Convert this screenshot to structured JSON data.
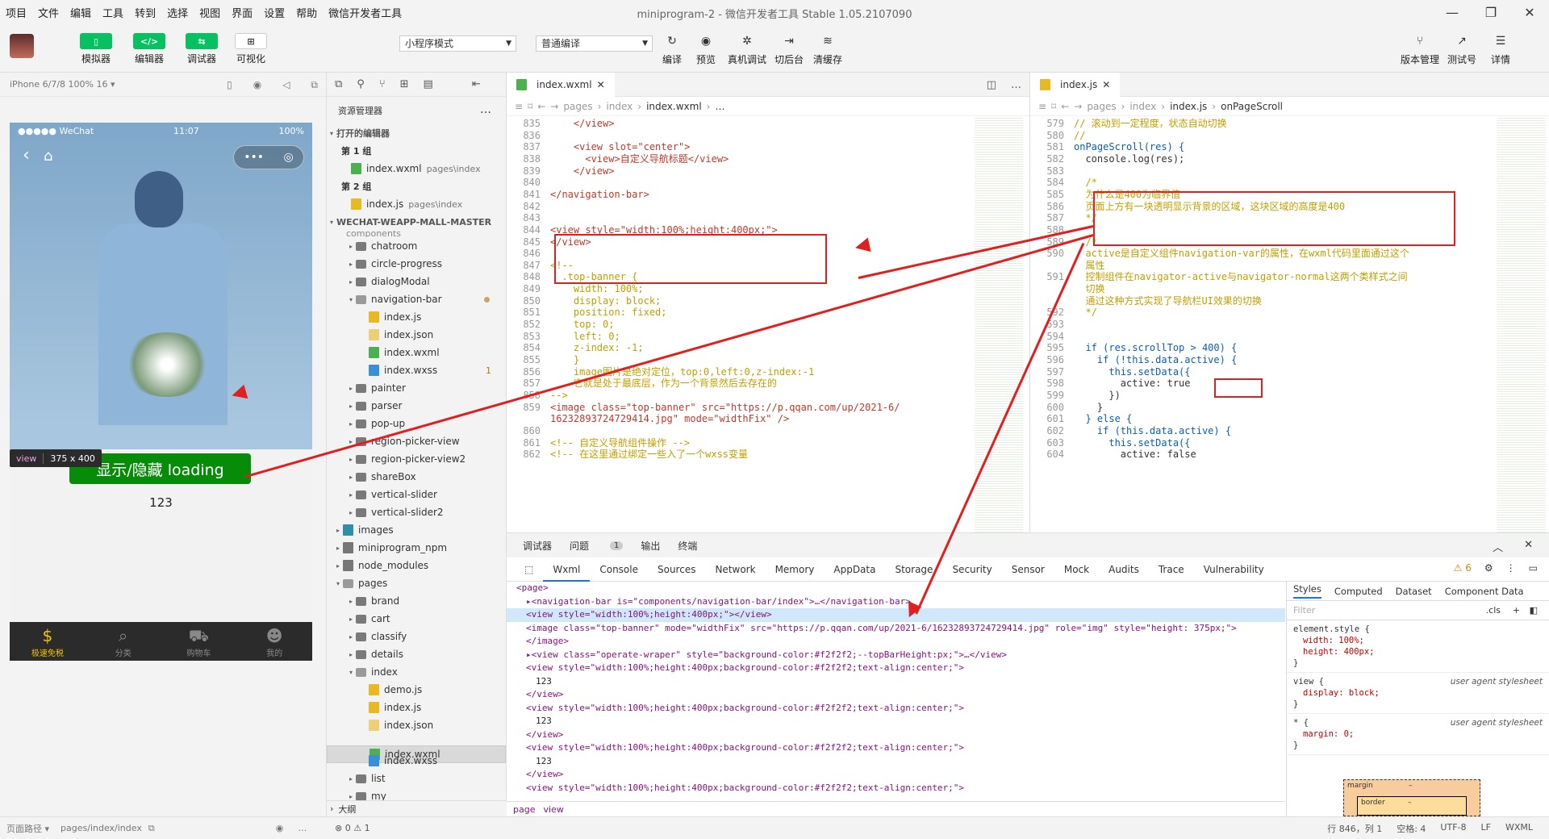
{
  "menu": [
    "项目",
    "文件",
    "编辑",
    "工具",
    "转到",
    "选择",
    "视图",
    "界面",
    "设置",
    "帮助",
    "微信开发者工具"
  ],
  "window_title": "miniprogram-2 - 微信开发者工具 Stable 1.05.2107090",
  "toolbar": {
    "left": [
      {
        "icon": "phone-icon",
        "label": "模拟器"
      },
      {
        "icon": "code-icon",
        "label": "编辑器"
      },
      {
        "icon": "debug-icon",
        "label": "调试器"
      },
      {
        "icon": "visual-icon",
        "label": "可视化"
      }
    ],
    "mode_select": "小程序模式",
    "compile_select": "普通编译",
    "mid": [
      {
        "icon": "refresh-icon",
        "label": "编译"
      },
      {
        "icon": "eye-icon",
        "label": "预览"
      },
      {
        "icon": "bug-icon",
        "label": "真机调试"
      },
      {
        "icon": "switch-icon",
        "label": "切后台"
      },
      {
        "icon": "layers-icon",
        "label": "清缓存"
      }
    ],
    "right": [
      {
        "icon": "branch-icon",
        "label": "版本管理"
      },
      {
        "icon": "share-icon",
        "label": "测试号"
      },
      {
        "icon": "menu-icon",
        "label": "详情"
      }
    ]
  },
  "simulator": {
    "device": "iPhone 6/7/8 100% 16 ▾",
    "status_left": "●●●●● WeChat",
    "status_time": "11:07",
    "status_right": "100%",
    "tooltip_tag": "view",
    "tooltip_size": "375 x 400",
    "button_label": "显示/隐藏 loading",
    "content_text": "123",
    "tabs": [
      {
        "label": "极速免税",
        "active": true,
        "icon": "money-bag-icon"
      },
      {
        "label": "分类",
        "active": false,
        "icon": "search-list-icon"
      },
      {
        "label": "购物车",
        "active": false,
        "icon": "cart-icon"
      },
      {
        "label": "我的",
        "active": false,
        "icon": "user-icon"
      }
    ],
    "footer_path_label": "页面路径 ▾",
    "footer_path": "pages/index/index"
  },
  "explorer": {
    "title": "资源管理器",
    "open_editors": "打开的编辑器",
    "groups": [
      {
        "name": "第 1 组",
        "file": "index.wxml",
        "path": "pages\\index"
      },
      {
        "name": "第 2 组",
        "file": "index.js",
        "path": "pages\\index"
      }
    ],
    "project": "WECHAT-WEAPP-MALL-MASTER",
    "cut_off": "components",
    "tree": [
      {
        "name": "chatroom",
        "type": "folder",
        "depth": 1
      },
      {
        "name": "circle-progress",
        "type": "folder",
        "depth": 1
      },
      {
        "name": "dialogModal",
        "type": "folder",
        "depth": 1
      },
      {
        "name": "navigation-bar",
        "type": "folderopen",
        "depth": 1
      },
      {
        "name": "index.js",
        "type": "js",
        "depth": 2
      },
      {
        "name": "index.json",
        "type": "json",
        "depth": 2
      },
      {
        "name": "index.wxml",
        "type": "wxml",
        "depth": 2
      },
      {
        "name": "index.wxss",
        "type": "wxss",
        "depth": 2,
        "badge": "1"
      },
      {
        "name": "painter",
        "type": "folder",
        "depth": 1
      },
      {
        "name": "parser",
        "type": "folder",
        "depth": 1
      },
      {
        "name": "pop-up",
        "type": "folder",
        "depth": 1
      },
      {
        "name": "region-picker-view",
        "type": "folder",
        "depth": 1
      },
      {
        "name": "region-picker-view2",
        "type": "folder",
        "depth": 1
      },
      {
        "name": "shareBox",
        "type": "folder",
        "depth": 1
      },
      {
        "name": "vertical-slider",
        "type": "folder",
        "depth": 1
      },
      {
        "name": "vertical-slider2",
        "type": "folder",
        "depth": 1
      },
      {
        "name": "images",
        "type": "img",
        "depth": 0
      },
      {
        "name": "miniprogram_npm",
        "type": "npm",
        "depth": 0
      },
      {
        "name": "node_modules",
        "type": "npm",
        "depth": 0
      },
      {
        "name": "pages",
        "type": "folderopen",
        "depth": 0
      },
      {
        "name": "brand",
        "type": "folder",
        "depth": 1
      },
      {
        "name": "cart",
        "type": "folder",
        "depth": 1
      },
      {
        "name": "classify",
        "type": "folder",
        "depth": 1
      },
      {
        "name": "details",
        "type": "folder",
        "depth": 1
      },
      {
        "name": "index",
        "type": "folderopen",
        "depth": 1
      },
      {
        "name": "demo.js",
        "type": "js",
        "depth": 2
      },
      {
        "name": "index.js",
        "type": "js",
        "depth": 2
      },
      {
        "name": "index.json",
        "type": "json",
        "depth": 2
      },
      {
        "name": "index.wxml",
        "type": "wxml",
        "depth": 2,
        "selected": true
      },
      {
        "name": "index.wxss",
        "type": "wxss",
        "depth": 2
      },
      {
        "name": "list",
        "type": "folder",
        "depth": 1
      },
      {
        "name": "my",
        "type": "folder",
        "depth": 1
      }
    ],
    "outline": "大纲"
  },
  "editor1": {
    "tab": "index.wxml",
    "crumb": [
      "pages",
      "index",
      "index.wxml",
      "…"
    ],
    "lines": [
      {
        "n": "835",
        "t": "    </view>",
        "c": "tag"
      },
      {
        "n": "836",
        "t": "",
        "c": ""
      },
      {
        "n": "837",
        "t": "    <view slot=\"center\">",
        "c": "tag"
      },
      {
        "n": "838",
        "t": "      <view>自定义导航标题</view>",
        "c": "tag"
      },
      {
        "n": "839",
        "t": "    </view>",
        "c": "tag"
      },
      {
        "n": "840",
        "t": "",
        "c": ""
      },
      {
        "n": "841",
        "t": "</navigation-bar>",
        "c": "tag"
      },
      {
        "n": "842",
        "t": "",
        "c": ""
      },
      {
        "n": "843",
        "t": "",
        "c": ""
      },
      {
        "n": "844",
        "t": "<view style=\"width:100%;height:400px;\">",
        "c": "tag"
      },
      {
        "n": "845",
        "t": "</view>",
        "c": "tag"
      },
      {
        "n": "846",
        "t": "",
        "c": ""
      },
      {
        "n": "847",
        "t": "<!--",
        "c": "cmt"
      },
      {
        "n": "848",
        "t": "  .top-banner {",
        "c": "cmt"
      },
      {
        "n": "849",
        "t": "    width: 100%;",
        "c": "cmt"
      },
      {
        "n": "850",
        "t": "    display: block;",
        "c": "cmt"
      },
      {
        "n": "851",
        "t": "    position: fixed;",
        "c": "cmt"
      },
      {
        "n": "852",
        "t": "    top: 0;",
        "c": "cmt"
      },
      {
        "n": "853",
        "t": "    left: 0;",
        "c": "cmt"
      },
      {
        "n": "854",
        "t": "    z-index: -1;",
        "c": "cmt"
      },
      {
        "n": "855",
        "t": "    }",
        "c": "cmt"
      },
      {
        "n": "856",
        "t": "    image图片是绝对定位，top:0,left:0,z-index:-1",
        "c": "cmt"
      },
      {
        "n": "857",
        "t": "    它就是处于最底层，作为一个背景然后去存在的",
        "c": "cmt"
      },
      {
        "n": "858",
        "t": "-->",
        "c": "cmt"
      },
      {
        "n": "859",
        "t": "<image class=\"top-banner\" src=\"https://p.qqan.com/up/2021-6/",
        "c": "tag"
      },
      {
        "n": "",
        "t": "16232893724729414.jpg\" mode=\"widthFix\" />",
        "c": "tag"
      },
      {
        "n": "860",
        "t": "",
        "c": ""
      },
      {
        "n": "861",
        "t": "<!-- 自定义导航组件操作 -->",
        "c": "cmt"
      },
      {
        "n": "862",
        "t": "<!-- 在这里通过绑定一些入了一个wxss变量",
        "c": "cmt"
      }
    ]
  },
  "editor2": {
    "tab": "index.js",
    "crumb": [
      "pages",
      "index",
      "index.js",
      "onPageScroll"
    ],
    "lines": [
      {
        "n": "579",
        "t": "// 滚动到一定程度，状态自动切换",
        "c": "cmt"
      },
      {
        "n": "580",
        "t": "//",
        "c": "cmt"
      },
      {
        "n": "581",
        "t": "onPageScroll(res) {",
        "c": "kw"
      },
      {
        "n": "582",
        "t": "  console.log(res);",
        "c": ""
      },
      {
        "n": "583",
        "t": "",
        "c": ""
      },
      {
        "n": "584",
        "t": "  /*",
        "c": "cmt"
      },
      {
        "n": "585",
        "t": "  为什么是400为临界值",
        "c": "cmt"
      },
      {
        "n": "586",
        "t": "  页面上方有一块透明显示背景的区域，这块区域的高度是400",
        "c": "cmt"
      },
      {
        "n": "587",
        "t": "  */",
        "c": "cmt"
      },
      {
        "n": "588",
        "t": "",
        "c": ""
      },
      {
        "n": "589",
        "t": "  /*",
        "c": "cmt"
      },
      {
        "n": "590",
        "t": "  active是自定义组件navigation-var的属性，在wxml代码里面通过这个",
        "c": "cmt"
      },
      {
        "n": "",
        "t": "  属性",
        "c": "cmt"
      },
      {
        "n": "591",
        "t": "  控制组件在navigator-active与navigator-normal这两个类样式之间",
        "c": "cmt"
      },
      {
        "n": "",
        "t": "  切换",
        "c": "cmt"
      },
      {
        "n": "",
        "t": "  通过这种方式实现了导航栏UI效果的切换",
        "c": "cmt"
      },
      {
        "n": "592",
        "t": "  */",
        "c": "cmt"
      },
      {
        "n": "593",
        "t": "",
        "c": ""
      },
      {
        "n": "594",
        "t": "",
        "c": ""
      },
      {
        "n": "595",
        "t": "  if (res.scrollTop > 400) {",
        "c": "kw"
      },
      {
        "n": "596",
        "t": "    if (!this.data.active) {",
        "c": "kw"
      },
      {
        "n": "597",
        "t": "      this.setData({",
        "c": "kw"
      },
      {
        "n": "598",
        "t": "        active: true",
        "c": ""
      },
      {
        "n": "599",
        "t": "      })",
        "c": ""
      },
      {
        "n": "600",
        "t": "    }",
        "c": ""
      },
      {
        "n": "601",
        "t": "  } else {",
        "c": "kw"
      },
      {
        "n": "602",
        "t": "    if (this.data.active) {",
        "c": "kw"
      },
      {
        "n": "603",
        "t": "      this.setData({",
        "c": "kw"
      },
      {
        "n": "604",
        "t": "        active: false",
        "c": ""
      }
    ]
  },
  "devtools": {
    "top_tabs": [
      "调试器",
      "问题",
      "输出",
      "终端"
    ],
    "issues_count": "1",
    "warn_count": "⚠ 6",
    "tabs": [
      "Wxml",
      "Console",
      "Sources",
      "Network",
      "Memory",
      "AppData",
      "Storage",
      "Security",
      "Sensor",
      "Mock",
      "Audits",
      "Trace",
      "Vulnerability"
    ],
    "dom": [
      {
        "indent": 0,
        "text": "<page>"
      },
      {
        "indent": 1,
        "text": "▸<navigation-bar is=\"components/navigation-bar/index\">…</navigation-bar>"
      },
      {
        "indent": 1,
        "text": "<view style=\"width:100%;height:400px;\"></view>",
        "hl": true
      },
      {
        "indent": 1,
        "text": "<image class=\"top-banner\" mode=\"widthFix\" src=\"https://p.qqan.com/up/2021-6/16232893724729414.jpg\" role=\"img\" style=\"height: 375px;\">"
      },
      {
        "indent": 1,
        "text": "</image>"
      },
      {
        "indent": 1,
        "text": "▸<view class=\"operate-wraper\" style=\"background-color:#f2f2f2;--topBarHeight:px;\">…</view>"
      },
      {
        "indent": 1,
        "text": "<view style=\"width:100%;height:400px;background-color:#f2f2f2;text-align:center;\">"
      },
      {
        "indent": 2,
        "text": "123"
      },
      {
        "indent": 1,
        "text": "</view>"
      },
      {
        "indent": 1,
        "text": "<view style=\"width:100%;height:400px;background-color:#f2f2f2;text-align:center;\">"
      },
      {
        "indent": 2,
        "text": "123"
      },
      {
        "indent": 1,
        "text": "</view>"
      },
      {
        "indent": 1,
        "text": "<view style=\"width:100%;height:400px;background-color:#f2f2f2;text-align:center;\">"
      },
      {
        "indent": 2,
        "text": "123"
      },
      {
        "indent": 1,
        "text": "</view>"
      },
      {
        "indent": 1,
        "text": "<view style=\"width:100%;height:400px;background-color:#f2f2f2;text-align:center;\">"
      }
    ],
    "dom_crumb": [
      "page",
      "view"
    ],
    "style_tabs": [
      "Styles",
      "Computed",
      "Dataset",
      "Component Data"
    ],
    "filter_placeholder": "Filter",
    "cls": ".cls",
    "rules": [
      {
        "sel": "element.style {",
        "src": "",
        "props": [
          "width: 100%;",
          "height: 400px;"
        ]
      },
      {
        "sel": "view {",
        "src": "user agent stylesheet",
        "props": [
          "display: block;"
        ]
      },
      {
        "sel": "* {",
        "src": "user agent stylesheet",
        "props": [
          "margin: 0;"
        ]
      }
    ],
    "box_margin": "margin",
    "box_border": "border",
    "box_dash": "–"
  },
  "statusbar": {
    "errors": "⊗ 0 ⚠ 1",
    "right": [
      "行 846，列 1",
      "空格: 4",
      "UTF-8",
      "LF",
      "WXML"
    ]
  }
}
